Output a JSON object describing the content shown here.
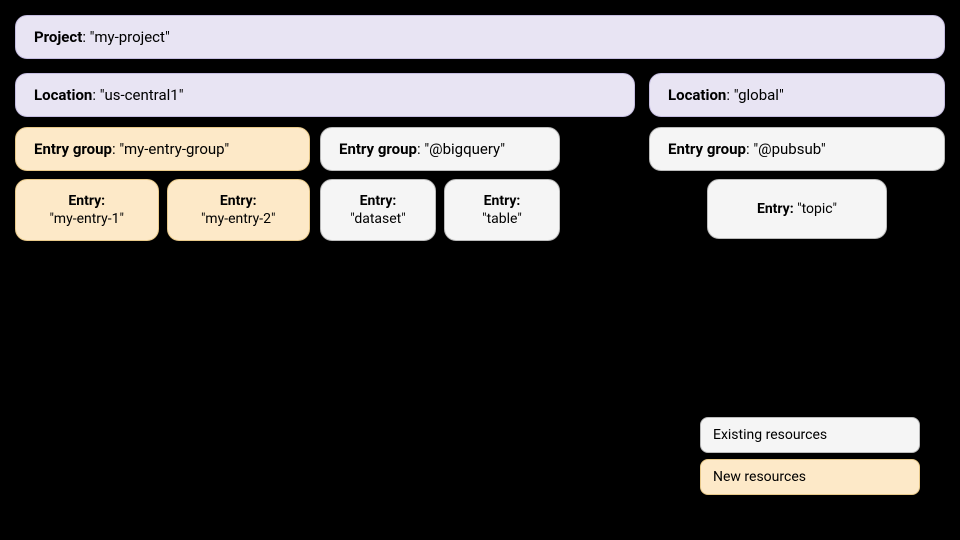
{
  "project": {
    "label": "Project",
    "value": "\"my-project\""
  },
  "locations": [
    {
      "id": "us-central1",
      "label": "Location",
      "value": "\"us-central1\"",
      "entryGroups": [
        {
          "id": "my-entry-group",
          "label": "Entry group",
          "value": "\"my-entry-group\"",
          "style": "orange",
          "entries": [
            {
              "label": "Entry",
              "value": "\"my-entry-1\"",
              "style": "orange"
            },
            {
              "label": "Entry",
              "value": "\"my-entry-2\"",
              "style": "orange"
            }
          ]
        },
        {
          "id": "bigquery",
          "label": "Entry group",
          "value": "\"@bigquery\"",
          "style": "white",
          "entries": [
            {
              "label": "Entry",
              "value": "\"dataset\"",
              "style": "white"
            },
            {
              "label": "Entry",
              "value": "\"table\"",
              "style": "white"
            }
          ]
        }
      ]
    },
    {
      "id": "global",
      "label": "Location",
      "value": "\"global\"",
      "entryGroups": [
        {
          "id": "pubsub",
          "label": "Entry group",
          "value": "\"@pubsub\"",
          "style": "white",
          "entries": [
            {
              "label": "Entry",
              "value": "\"topic\"",
              "style": "white"
            }
          ]
        }
      ]
    }
  ],
  "legend": {
    "existing_label": "Existing resources",
    "new_label": "New resources"
  }
}
